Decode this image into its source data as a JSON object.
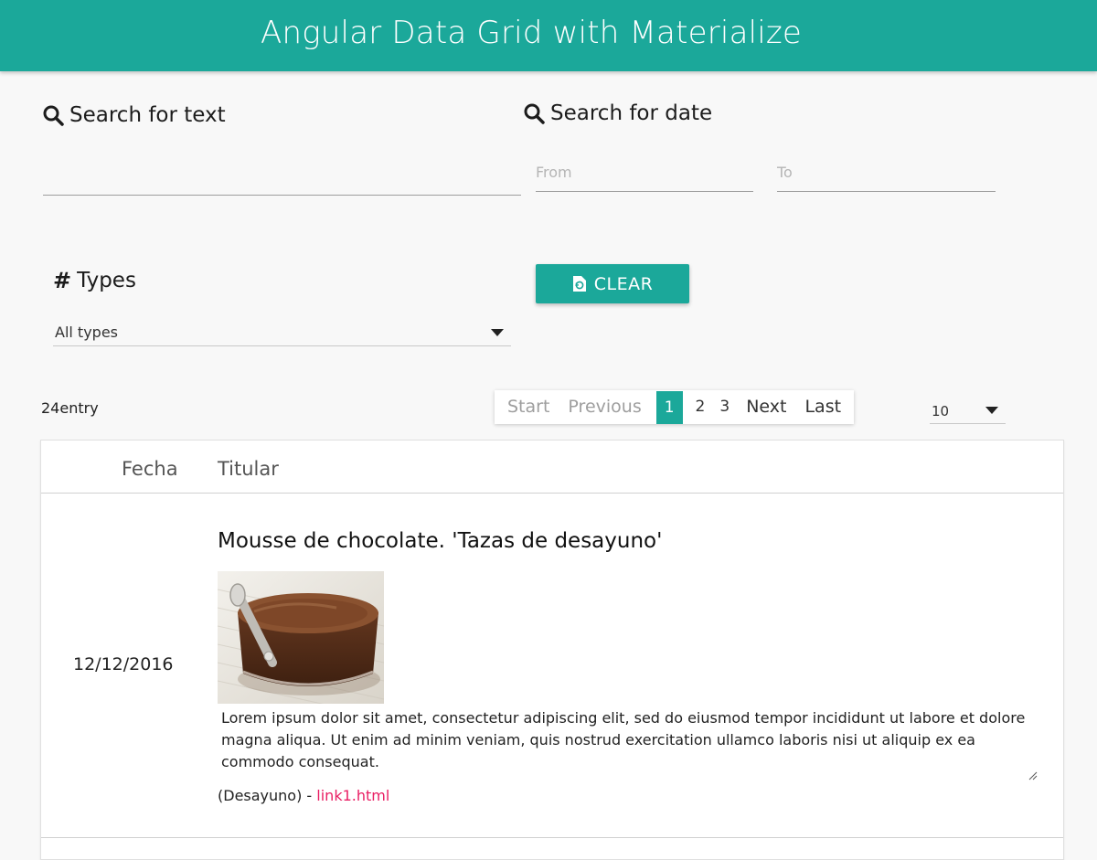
{
  "header": {
    "title": "Angular Data Grid with Materialize"
  },
  "search_text": {
    "label": "Search for text",
    "value": ""
  },
  "search_date": {
    "label": "Search for date",
    "from_placeholder": "From",
    "to_placeholder": "To"
  },
  "types": {
    "label": "Types",
    "selected": "All types"
  },
  "clear_button": {
    "label": "CLEAR"
  },
  "entry_count": "24entry",
  "pagination": {
    "start": "Start",
    "previous": "Previous",
    "pages": [
      "1",
      "2",
      "3"
    ],
    "active_page": "1",
    "next": "Next",
    "last": "Last"
  },
  "page_size": {
    "selected": "10"
  },
  "table": {
    "columns": [
      "Fecha",
      "Titular"
    ],
    "rows": [
      {
        "date": "12/12/2016",
        "title": "Mousse de chocolate. 'Tazas de desayuno'",
        "body": "Lorem ipsum dolor sit amet, consectetur adipiscing elit, sed do eiusmod tempor incididunt ut labore et dolore magna aliqua. Ut enim ad minim veniam, quis nostrud exercitation ullamco laboris nisi ut aliquip ex ea commodo consequat.",
        "category": "(Desayuno) - ",
        "link": "link1.html"
      }
    ]
  },
  "colors": {
    "primary": "#1ba89a",
    "link": "#e91e63"
  },
  "icons": {
    "search": "search-icon",
    "hash": "hash-icon",
    "clear": "reset-file-icon",
    "dropdown": "caret-down-icon"
  }
}
